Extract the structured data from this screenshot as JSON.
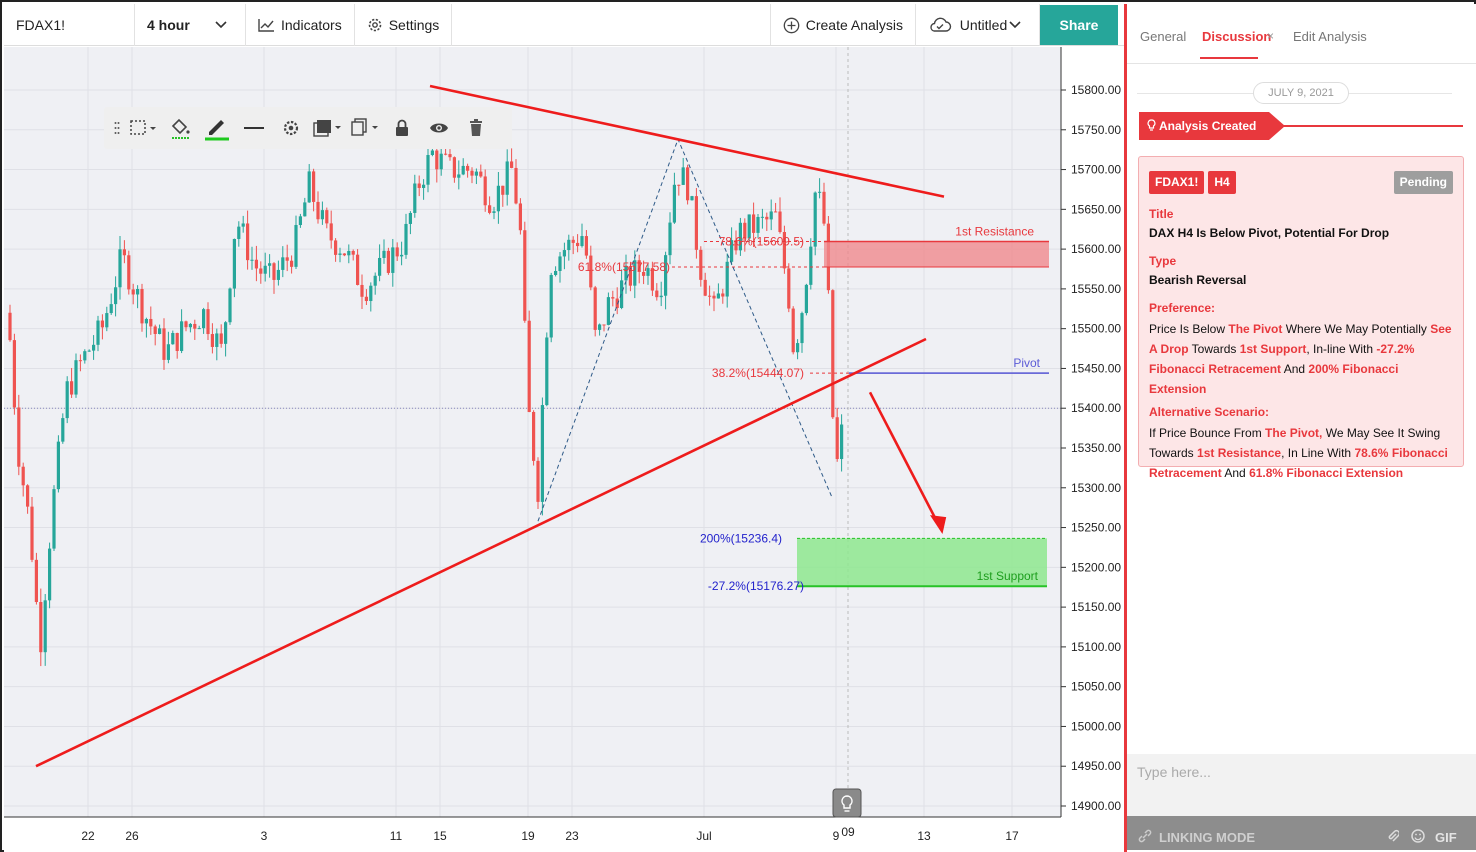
{
  "toolbar": {
    "symbol": "FDAX1!",
    "interval": "4 hour",
    "indicators": "Indicators",
    "settings": "Settings",
    "create_analysis": "Create Analysis",
    "layout_name": "Untitled",
    "share": "Share"
  },
  "panel": {
    "tabs": [
      "General",
      "Discussion",
      "Edit Analysis"
    ],
    "date": "JULY 9, 2021",
    "created": "Analysis Created",
    "card": {
      "symbol": "FDAX1!",
      "timeframe": "H4",
      "status": "Pending",
      "title_label": "Title",
      "title": "DAX H4 Is Below Pivot, Potential For Drop",
      "type_label": "Type",
      "type": "Bearish Reversal",
      "preference_label": "Preference:",
      "preference": {
        "p1": "Price Is Below ",
        "h1": "The Pivot",
        "p2": " Where We May Potentially ",
        "h2": "See A Drop",
        "p3": " Towards ",
        "h3": "1st Support",
        "p4": ", In-line With ",
        "h4": "-27.2%",
        "h5": "Fibonacci Retracement",
        "p5": " And ",
        "h6": "200% Fibonacci Extension"
      },
      "alternative_label": "Alternative Scenario:",
      "alternative": {
        "p1": "If Price Bounce From ",
        "h1": "The Pivot,",
        "p2": " We May See It Swing Towards ",
        "h2": "1st Resistance",
        "p3": ", In Line With ",
        "h3": "78.6% Fibonacci Retracement",
        "p4": " And ",
        "h4": "61.8% Fibonacci Extension"
      }
    },
    "input_placeholder": "Type here...",
    "linking_mode": "LINKING MODE",
    "gif": "GIF"
  },
  "chart_data": {
    "type": "candlestick",
    "symbol": "FDAX1!",
    "y_ticks": [
      15800,
      15750,
      15700,
      15650,
      15600,
      15550,
      15500,
      15450,
      15400,
      15350,
      15300,
      15250,
      15200,
      15150,
      15100,
      15050,
      15000,
      14950,
      14900
    ],
    "ylim": [
      14880,
      15830
    ],
    "x_ticks": [
      "22",
      "26",
      "3",
      "11",
      "15",
      "19",
      "23",
      "Jul",
      "9",
      "13",
      "17"
    ],
    "x_highlight": "09",
    "levels": [
      {
        "label": "1st Resistance",
        "value": 15609.5,
        "color": "#e8383d"
      },
      {
        "label": "Pivot",
        "value": 15444.07,
        "color": "#5b5bd6"
      },
      {
        "label": "1st Support",
        "value": 15176.27,
        "color": "#27c227"
      }
    ],
    "fib_labels": [
      {
        "text": "78.6%(15609.5)",
        "value": 15609.5,
        "color": "#e8383d"
      },
      {
        "text": "61.8%(15577.58)",
        "value": 15577.58,
        "color": "#e8383d"
      },
      {
        "text": "38.2%(15444.07)",
        "value": 15444.07,
        "color": "#e8383d"
      },
      {
        "text": "200%(15236.4)",
        "value": 15236.4,
        "color": "#2222cc"
      },
      {
        "text": "-27.2%(15176.27)",
        "value": 15176.27,
        "color": "#2222cc"
      }
    ],
    "current_price": 15400
  }
}
